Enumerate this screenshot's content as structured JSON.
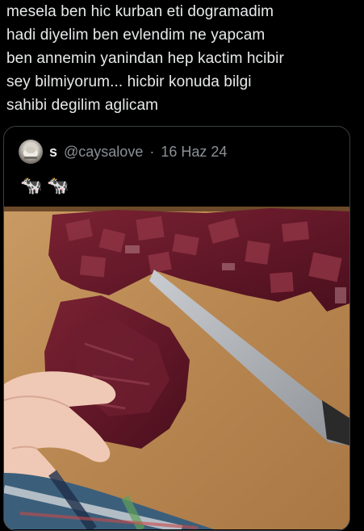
{
  "tweet": {
    "text": "mesela ben hic kurban eti dogramadim\nhadi diyelim ben evlendim ne yapcam\nben annemin yanindan hep kactim hcibir\nsey bilmiyorum... hicbir konuda bilgi\nsahibi degilim aglicam"
  },
  "quote": {
    "name": "s",
    "handle": "@caysalove",
    "separator": "·",
    "date": "16 Haz 24",
    "emoji": [
      "🐄",
      "🐄"
    ],
    "image_icon": "photo-of-cubed-raw-meat-on-cutting-board"
  },
  "colors": {
    "background": "#000000",
    "text": "#e7e9ea",
    "secondary_text": "#8b9096",
    "border": "#3a3d41"
  }
}
